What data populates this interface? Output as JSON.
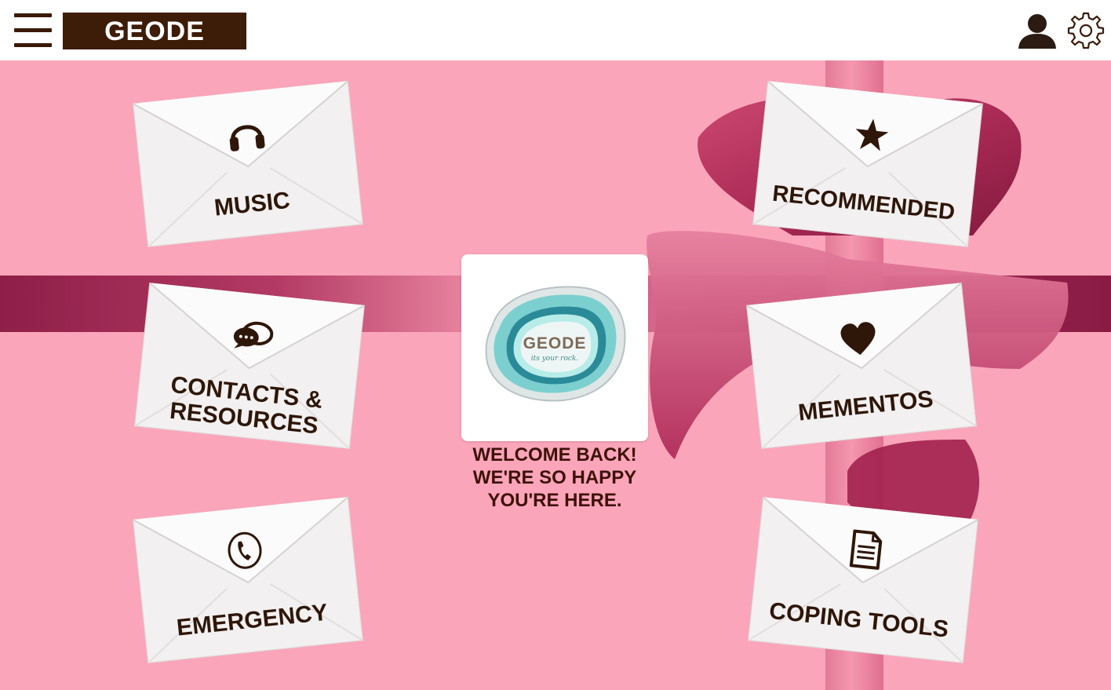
{
  "app": {
    "brand": "GEODE",
    "menu_icon": "hamburger-menu-icon",
    "user_icon": "user-profile-icon",
    "settings_icon": "gear-icon"
  },
  "colors": {
    "brand_brown": "#3d1c08",
    "background_pink": "#fba5ba",
    "ribbon_dark": "#8e1f48",
    "envelope_white": "#f4f2f2",
    "text_dark": "#2e1609"
  },
  "tiles": {
    "music": {
      "label": "MUSIC",
      "icon": "headphones-icon"
    },
    "contacts": {
      "label_line1": "CONTACTS &",
      "label_line2": "RESOURCES",
      "icon": "chat-bubbles-icon"
    },
    "emergency": {
      "label": "EMERGENCY",
      "icon": "phone-icon"
    },
    "recommended": {
      "label": "RECOMMENDED",
      "icon": "star-icon"
    },
    "mementos": {
      "label": "MEMENTOS",
      "icon": "heart-icon"
    },
    "coping": {
      "label": "COPING TOOLS",
      "icon": "document-icon"
    }
  },
  "center": {
    "logo_word": "GEODE",
    "logo_tagline": "its your rock.",
    "welcome_line1": "WELCOME BACK!",
    "welcome_line2": "WE'RE SO HAPPY",
    "welcome_line3": "YOU'RE HERE."
  }
}
